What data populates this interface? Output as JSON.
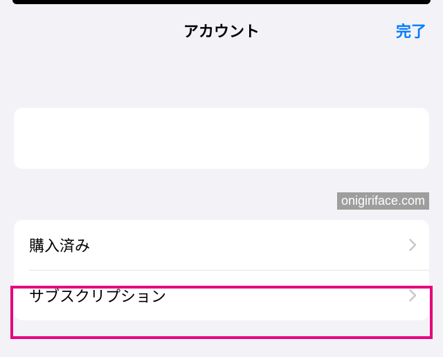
{
  "header": {
    "title": "アカウント",
    "done_label": "完了"
  },
  "list": {
    "items": [
      {
        "label": "購入済み"
      },
      {
        "label": "サブスクリプション"
      }
    ]
  },
  "watermark": "onigiriface.com"
}
